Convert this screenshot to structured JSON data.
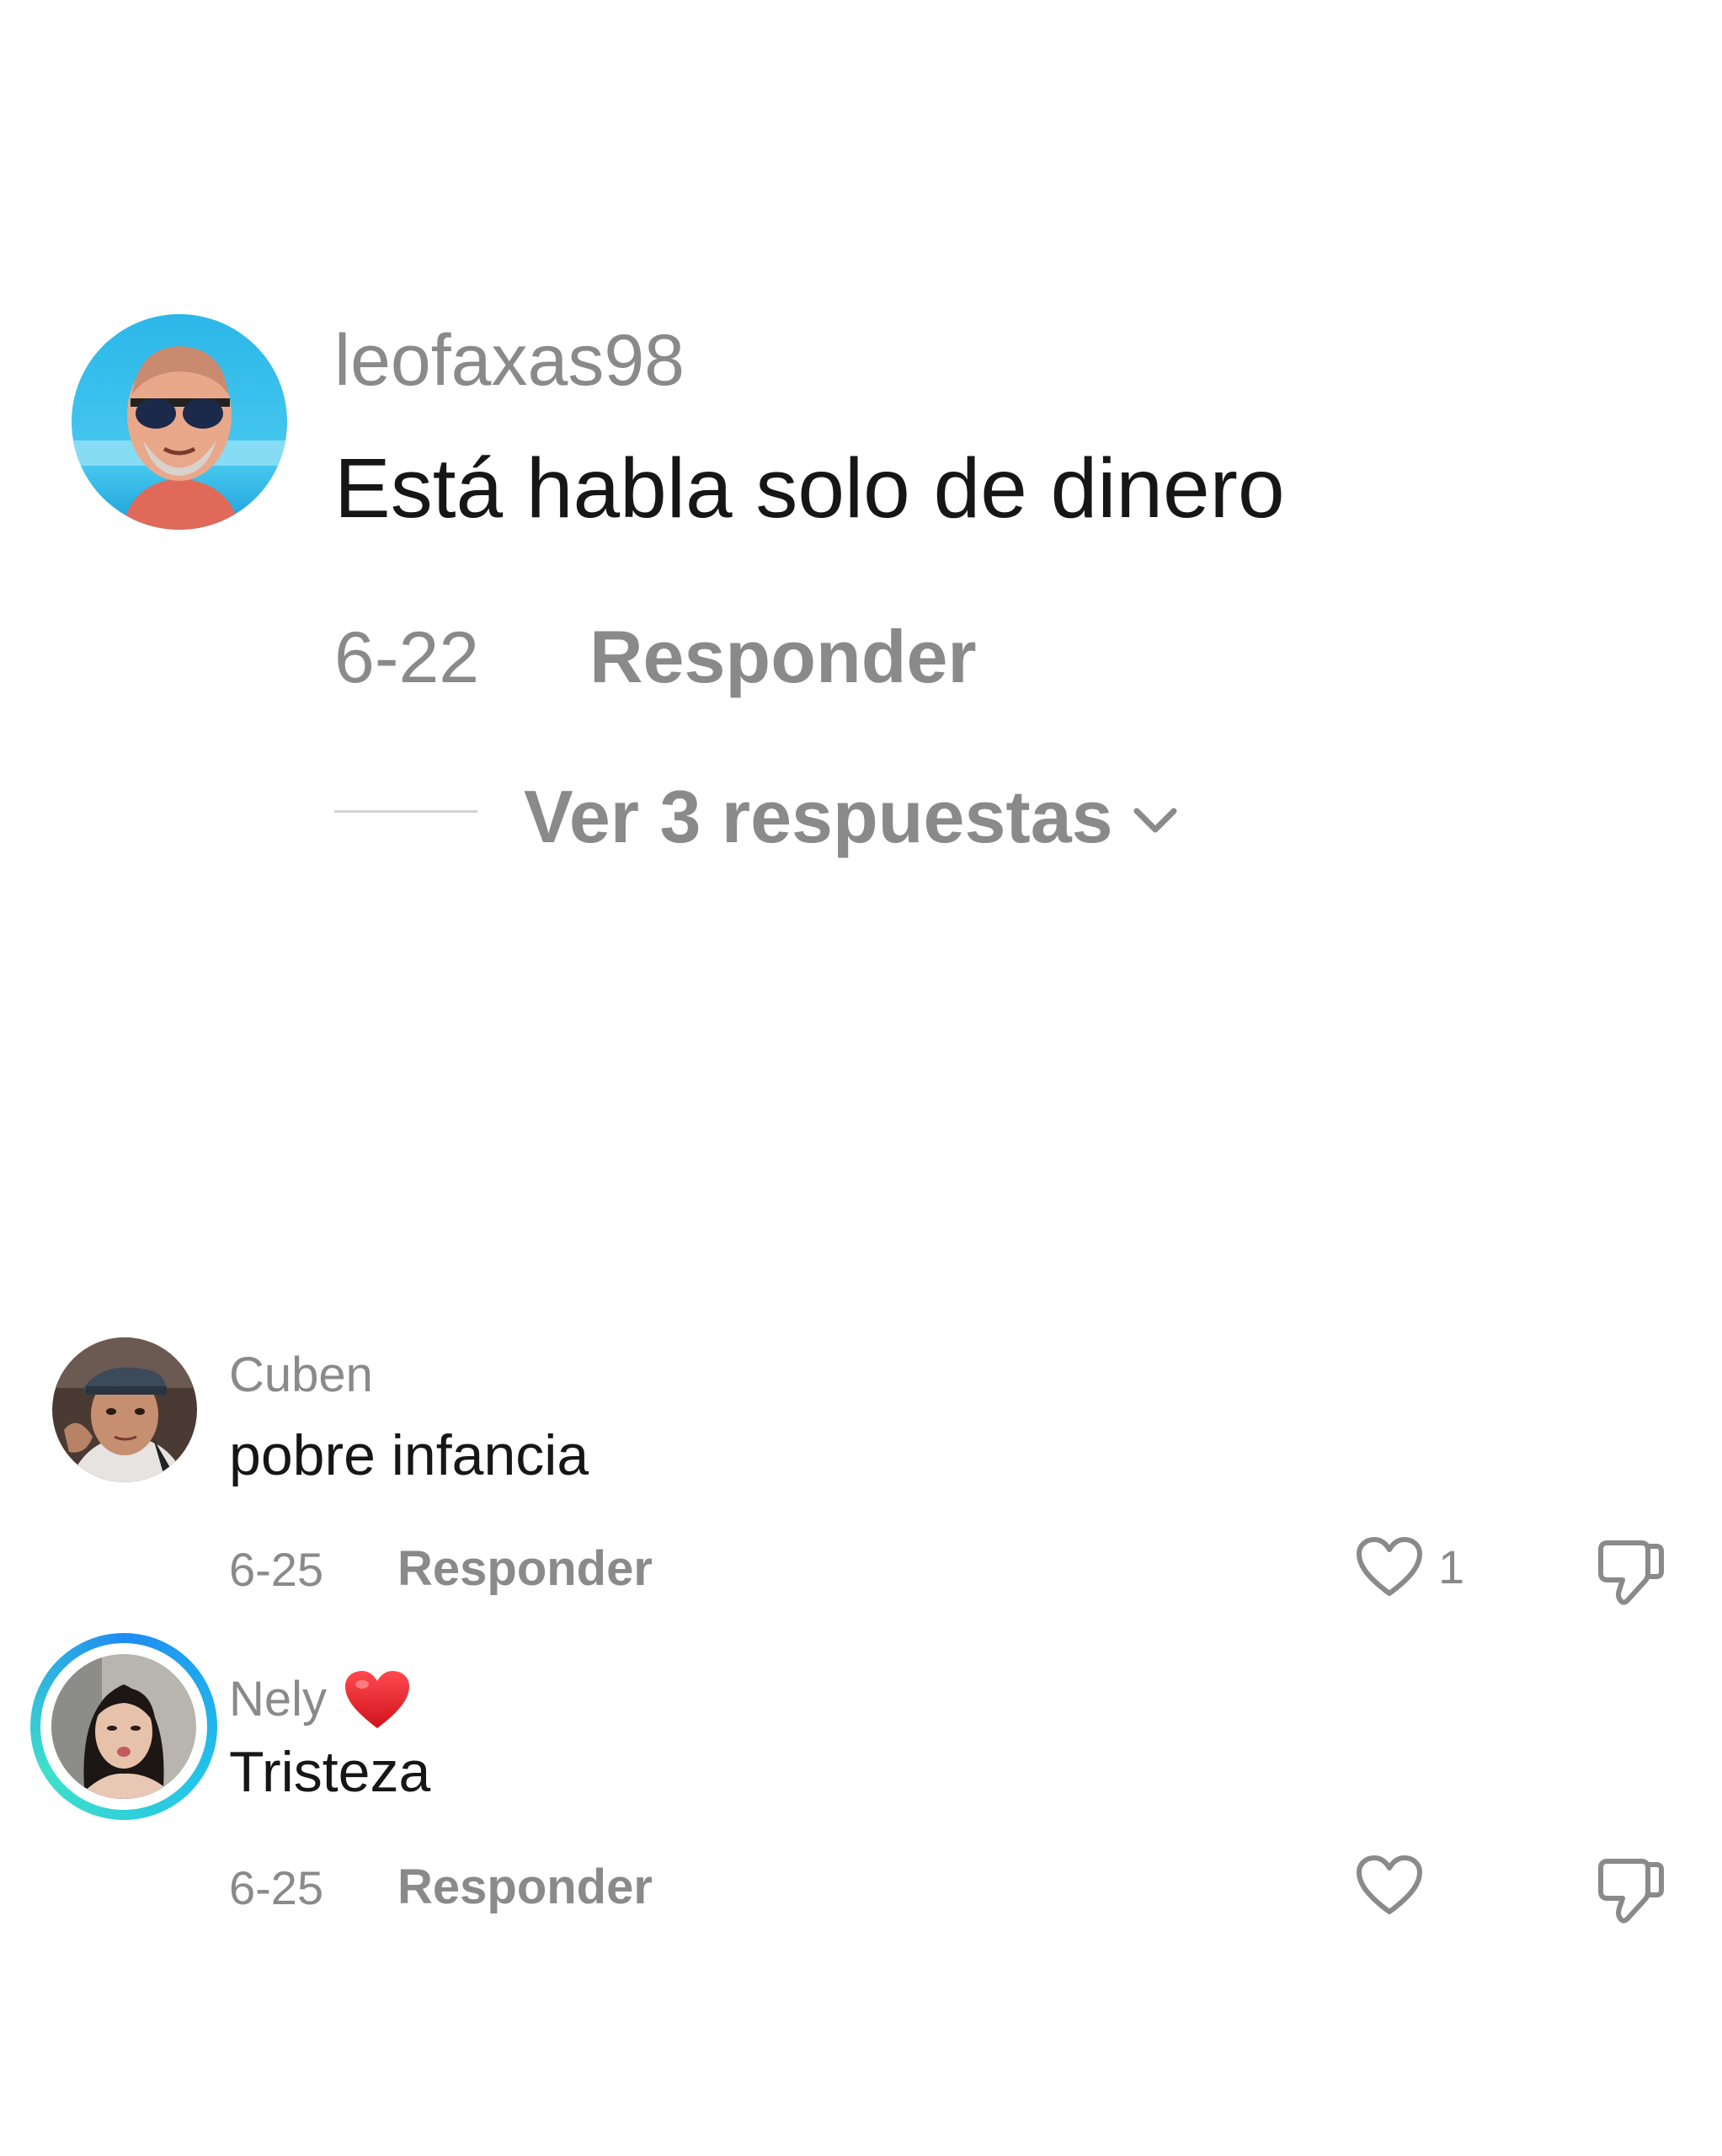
{
  "main_comment": {
    "username": "leofaxas98",
    "text": "Está habla solo de dinero",
    "date": "6-22",
    "reply_label": "Responder",
    "view_replies_label": "Ver 3 respuestas",
    "avatar_icon": "avatar-man-sunglasses"
  },
  "replies": [
    {
      "username": "Cuben",
      "text": "pobre infancia",
      "date": "6-25",
      "reply_label": "Responder",
      "like_count": "1",
      "avatar_icon": "avatar-young-man-cap"
    },
    {
      "username": "Nely",
      "username_emoji": "red-heart-icon",
      "text": "Tristeza",
      "date": "6-25",
      "reply_label": "Responder",
      "like_count": "",
      "avatar_icon": "avatar-woman-story-ring",
      "story_ring_colors": [
        "#1f8cf2",
        "#22c3e8",
        "#3fe0c9"
      ]
    }
  ],
  "colors": {
    "background": "#ffffff",
    "primary_text": "#161616",
    "secondary_text": "#8a8a8a",
    "divider": "#d3d3d3",
    "heart_emoji": "#e8202a"
  }
}
